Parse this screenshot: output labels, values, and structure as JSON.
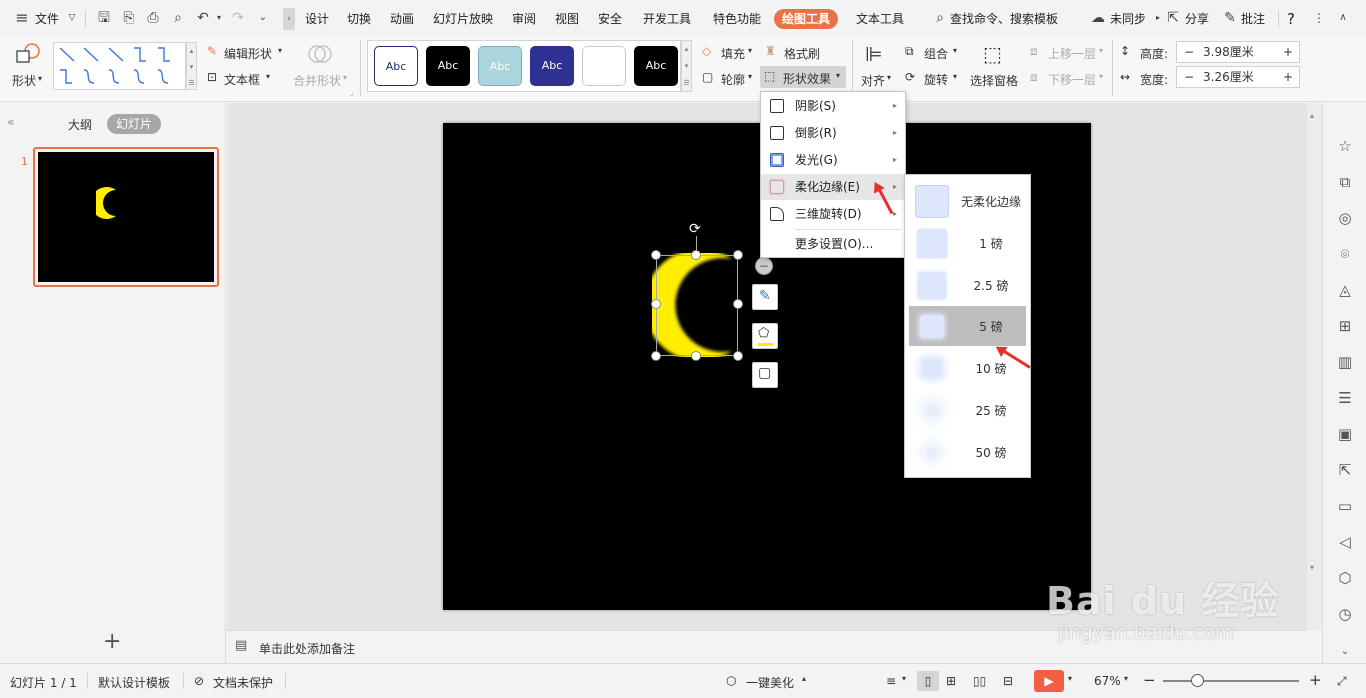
{
  "tabs": {
    "file": "文件",
    "design": "设计",
    "transition": "切换",
    "animation": "动画",
    "slideshow": "幻灯片放映",
    "review": "审阅",
    "view": "视图",
    "security": "安全",
    "developer": "开发工具",
    "special": "特色功能",
    "drawing": "绘图工具",
    "text": "文本工具",
    "search": "查找命令、搜索模板",
    "sync": "未同步",
    "share": "分享",
    "comment": "批注",
    "help": "?"
  },
  "ribbon": {
    "shape": "形状",
    "edit_shape": "编辑形状",
    "textbox": "文本框",
    "merge_shape": "合并形状",
    "style_sample": "Abc",
    "fill": "填充",
    "format_painter": "格式刷",
    "outline": "轮廓",
    "shape_effect": "形状效果",
    "align": "对齐",
    "group": "组合",
    "rotate": "旋转",
    "selection_pane": "选择窗格",
    "bring_forward": "上移一层",
    "send_backward": "下移一层",
    "height_label": "高度:",
    "height_value": "3.98厘米",
    "width_label": "宽度:",
    "width_value": "3.26厘米",
    "minus": "−",
    "plus": "+"
  },
  "left_panel": {
    "outline_tab": "大纲",
    "slides_tab": "幻灯片",
    "slide_number": "1",
    "add": "+"
  },
  "notes": {
    "placeholder": "单击此处添加备注"
  },
  "effect_menu": {
    "items": [
      {
        "label": "阴影(S)"
      },
      {
        "label": "倒影(R)"
      },
      {
        "label": "发光(G)"
      },
      {
        "label": "柔化边缘(E)"
      },
      {
        "label": "三维旋转(D)"
      },
      {
        "label": "更多设置(O)..."
      }
    ]
  },
  "soft_edge_menu": {
    "items": [
      {
        "label": "无柔化边缘",
        "blur": 0
      },
      {
        "label": "1 磅",
        "blur": 1
      },
      {
        "label": "2.5 磅",
        "blur": 2.5
      },
      {
        "label": "5 磅",
        "blur": 5
      },
      {
        "label": "10 磅",
        "blur": 10
      },
      {
        "label": "25 磅",
        "blur": 25
      },
      {
        "label": "50 磅",
        "blur": 50
      }
    ],
    "selected_index": 3
  },
  "status": {
    "slide_info": "幻灯片 1 / 1",
    "template": "默认设计模板",
    "protect": "文档未保护",
    "beautify": "一键美化",
    "zoom": "67%",
    "zoom_fraction": 0.25
  },
  "colors": {
    "accent": "#e8734a",
    "moon": "#ffee00",
    "play": "#f25f45",
    "arrow": "#e8302a"
  },
  "watermark": {
    "brand": "Bai du 经验",
    "url": "jingyan.baidu.com"
  }
}
